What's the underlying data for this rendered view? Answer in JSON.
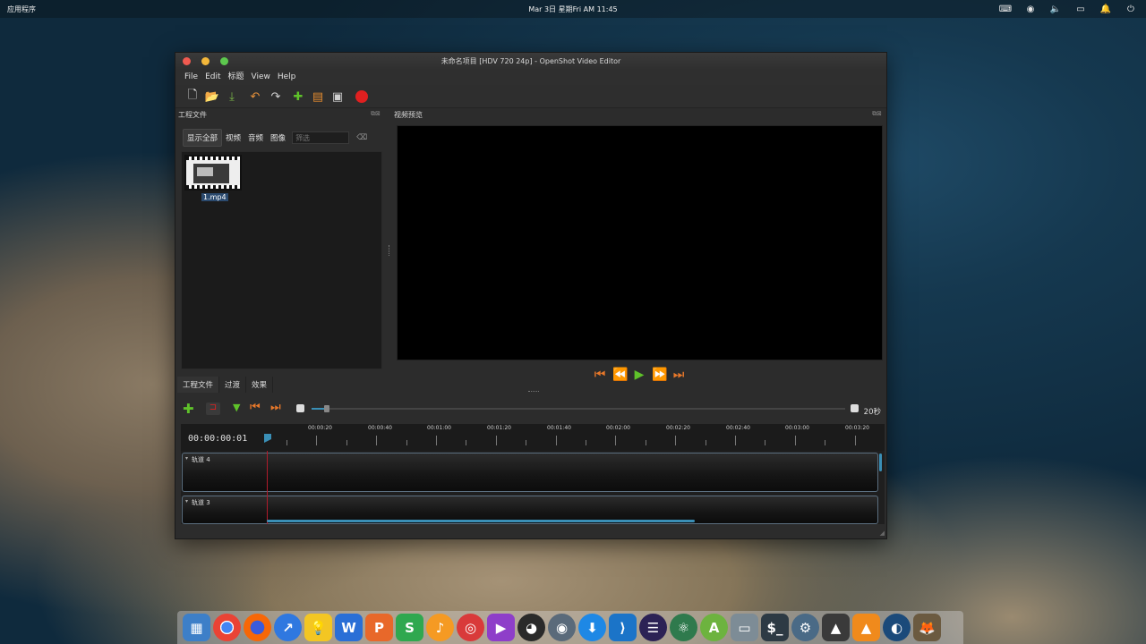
{
  "topbar": {
    "apps_label": "应用程序",
    "datetime": "Mar 3日 星期Fri   AM 11:45"
  },
  "window": {
    "title": "未命名项目 [HDV 720 24p] - OpenShot Video Editor",
    "menu": [
      "File",
      "Edit",
      "标题",
      "View",
      "Help"
    ],
    "toolbar_icons": [
      "new-project-icon",
      "open-project-icon",
      "save-project-icon",
      "undo-icon",
      "redo-icon",
      "import-files-icon",
      "choose-profile-icon",
      "fullscreen-icon",
      "export-video-icon"
    ]
  },
  "project_files": {
    "title": "工程文件",
    "filters": [
      "显示全部",
      "视频",
      "音频",
      "图像"
    ],
    "filter_placeholder": "筛选",
    "items": [
      {
        "name": "1.mp4"
      }
    ]
  },
  "preview": {
    "title": "视频预览"
  },
  "bottom_tabs": [
    "工程文件",
    "过渡",
    "效果"
  ],
  "timeline": {
    "scale_label": "20秒",
    "current_time": "00:00:00:01",
    "ruler_labels": [
      "00:00:20",
      "00:00:40",
      "00:01:00",
      "00:01:20",
      "00:01:40",
      "00:02:00",
      "00:02:20",
      "00:02:40",
      "00:03:00",
      "00:03:20"
    ],
    "tracks": [
      {
        "name": "轨道 4"
      },
      {
        "name": "轨道 3"
      }
    ]
  },
  "dock": {
    "apps": [
      "app-launcher",
      "chrome",
      "firefox",
      "safari",
      "idea",
      "wps-writer",
      "wps-presentation",
      "wps-spreadsheet",
      "music",
      "netease-music",
      "video-player",
      "obs",
      "uget",
      "downloader",
      "vscode",
      "eclipse",
      "atom",
      "android-studio",
      "files",
      "terminal",
      "settings",
      "inkscape",
      "vlc",
      "steam",
      "gimp"
    ]
  }
}
